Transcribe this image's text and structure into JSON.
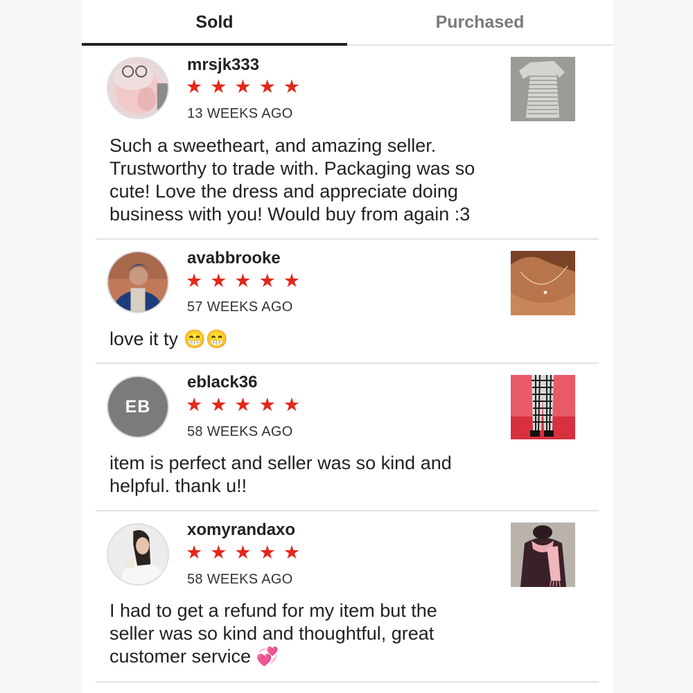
{
  "tabs": {
    "sold": "Sold",
    "purchased": "Purchased",
    "active": "sold"
  },
  "reviews": [
    {
      "username": "mrsjk333",
      "stars": "★★★★★",
      "rating": 5,
      "time": "13 WEEKS AGO",
      "comment_lines": [
        "Such a sweetheart, and amazing seller.",
        "Trustworthy to trade with. Packaging was so",
        "cute! Love the dress and appreciate doing",
        "business with you! Would buy from again :3"
      ]
    },
    {
      "username": "avabbrooke",
      "stars": "★★★★★",
      "rating": 5,
      "time": "57 WEEKS AGO",
      "comment": "love it ty",
      "emoji": "😁😁"
    },
    {
      "username": "eblack36",
      "initials": "EB",
      "stars": "★★★★★",
      "rating": 5,
      "time": "58 WEEKS AGO",
      "comment_lines": [
        "item is perfect and seller was so kind and",
        "helpful. thank u!!"
      ]
    },
    {
      "username": "xomyrandaxo",
      "stars": "★★★★★",
      "rating": 5,
      "time": "58 WEEKS AGO",
      "comment_lines": [
        "I had to get a refund for my item but the",
        "seller was so kind and thoughtful, great",
        "customer service"
      ],
      "emoji": "💞"
    }
  ],
  "colors": {
    "star": "#e3281a",
    "tab_active": "#222222",
    "tab_inactive": "#7a7a7a",
    "avatar_initials_bg": "#7b7b7b"
  }
}
